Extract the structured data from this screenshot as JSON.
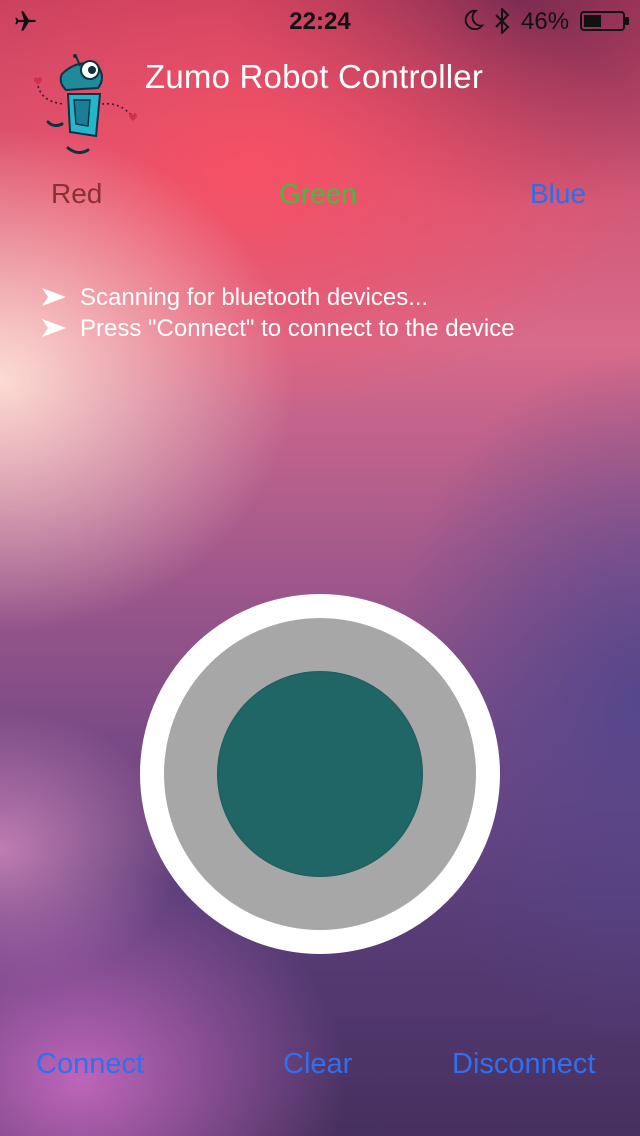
{
  "status_bar": {
    "time": "22:24",
    "battery_percent": "46%",
    "battery_level": 0.46,
    "icons": [
      "airplane-icon",
      "moon-icon",
      "bluetooth-icon",
      "battery-icon"
    ]
  },
  "header": {
    "title": "Zumo Robot Controller",
    "logo_icon": "robot-mascot-icon"
  },
  "color_labels": {
    "red": "Red",
    "green": "Green",
    "blue": "Blue",
    "colors": {
      "red": "#8a3030",
      "green": "#3cbf3c",
      "blue": "#2a6ff0"
    }
  },
  "messages": [
    "Scanning for bluetooth devices...",
    "Press \"Connect\" to connect to the device"
  ],
  "joystick": {
    "knob_color": "#216666",
    "track_color": "#a7a7a7",
    "ring_color": "#ffffff"
  },
  "bottom_buttons": {
    "connect": "Connect",
    "clear": "Clear",
    "disconnect": "Disconnect",
    "color": "#2f6ff0"
  }
}
